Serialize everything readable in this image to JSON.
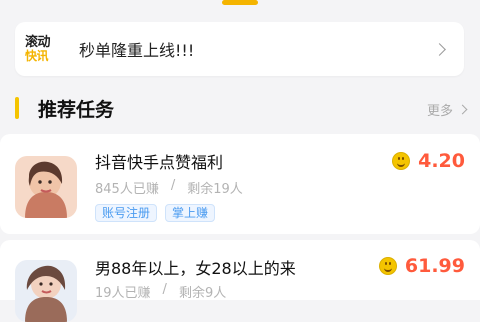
{
  "header": {
    "tab_indicator_color": "#f4b400"
  },
  "news": {
    "logo_line1": "滚动",
    "logo_line2": "快讯",
    "text": "秒单隆重上线!!!",
    "icon": "chevron-right-icon"
  },
  "section": {
    "title": "推荐任务",
    "more_label": "更多",
    "accent_color": "#f4c400"
  },
  "tasks": [
    {
      "title": "抖音快手点赞福利",
      "earned": "845人已赚",
      "separator": "/",
      "remaining": "剩余19人",
      "tags": [
        "账号注册",
        "掌上赚"
      ],
      "reward": "4.20",
      "reward_color": "#ff5a3c",
      "icon": "smiley-coin-icon"
    },
    {
      "title": "男88年以上，女28以上的来",
      "earned": "19人已赚",
      "separator": "/",
      "remaining": "剩余9人",
      "tags": [],
      "reward": "61.99",
      "reward_color": "#ff5a3c",
      "icon": "smiley-coin-icon"
    }
  ]
}
